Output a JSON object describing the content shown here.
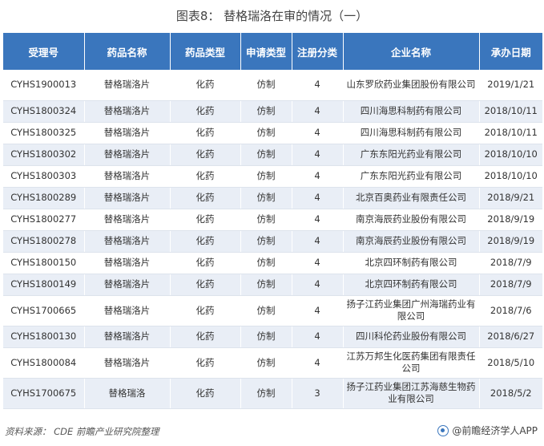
{
  "title": "图表8：  替格瑞洛在审的情况（一）",
  "columns": [
    "受理号",
    "药品名称",
    "药品类型",
    "申请类型",
    "注册分类",
    "企业名称",
    "承办日期"
  ],
  "rows": [
    [
      "CYHS1900013",
      "替格瑞洛片",
      "化药",
      "仿制",
      "4",
      "山东罗欣药业集团股份有限公司",
      "2019/1/21"
    ],
    [
      "CYHS1800324",
      "替格瑞洛片",
      "化药",
      "仿制",
      "4",
      "四川海思科制药有限公司",
      "2018/10/11"
    ],
    [
      "CYHS1800325",
      "替格瑞洛片",
      "化药",
      "仿制",
      "4",
      "四川海思科制药有限公司",
      "2018/10/11"
    ],
    [
      "CYHS1800302",
      "替格瑞洛片",
      "化药",
      "仿制",
      "4",
      "广东东阳光药业有限公司",
      "2018/10/10"
    ],
    [
      "CYHS1800303",
      "替格瑞洛片",
      "化药",
      "仿制",
      "4",
      "广东东阳光药业有限公司",
      "2018/10/10"
    ],
    [
      "CYHS1800289",
      "替格瑞洛片",
      "化药",
      "仿制",
      "4",
      "北京百奥药业有限责任公司",
      "2018/9/21"
    ],
    [
      "CYHS1800277",
      "替格瑞洛片",
      "化药",
      "仿制",
      "4",
      "南京海辰药业股份有限公司",
      "2018/9/19"
    ],
    [
      "CYHS1800278",
      "替格瑞洛片",
      "化药",
      "仿制",
      "4",
      "南京海辰药业股份有限公司",
      "2018/9/19"
    ],
    [
      "CYHS1800150",
      "替格瑞洛片",
      "化药",
      "仿制",
      "4",
      "北京四环制药有限公司",
      "2018/7/9"
    ],
    [
      "CYHS1800149",
      "替格瑞洛片",
      "化药",
      "仿制",
      "4",
      "北京四环制药有限公司",
      "2018/7/9"
    ],
    [
      "CYHS1700665",
      "替格瑞洛片",
      "化药",
      "仿制",
      "4",
      "扬子江药业集团广州海瑞药业有限公司",
      "2018/7/6"
    ],
    [
      "CYHS1800130",
      "替格瑞洛片",
      "化药",
      "仿制",
      "4",
      "四川科伦药业股份有限公司",
      "2018/6/27"
    ],
    [
      "CYHS1800084",
      "替格瑞洛片",
      "化药",
      "仿制",
      "4",
      "江苏万邦生化医药集团有限责任公司",
      "2018/5/10"
    ],
    [
      "CYHS1700675",
      "替格瑞洛",
      "化药",
      "仿制",
      "3",
      "扬子江药业集团江苏海慈生物药业有限公司",
      "2018/5/2"
    ]
  ],
  "footer": {
    "source": "资料来源：  CDE  前瞻产业研究院整理",
    "brand": "@前瞻经济学人APP",
    "brand_icon": "qianzhan-logo-icon"
  }
}
